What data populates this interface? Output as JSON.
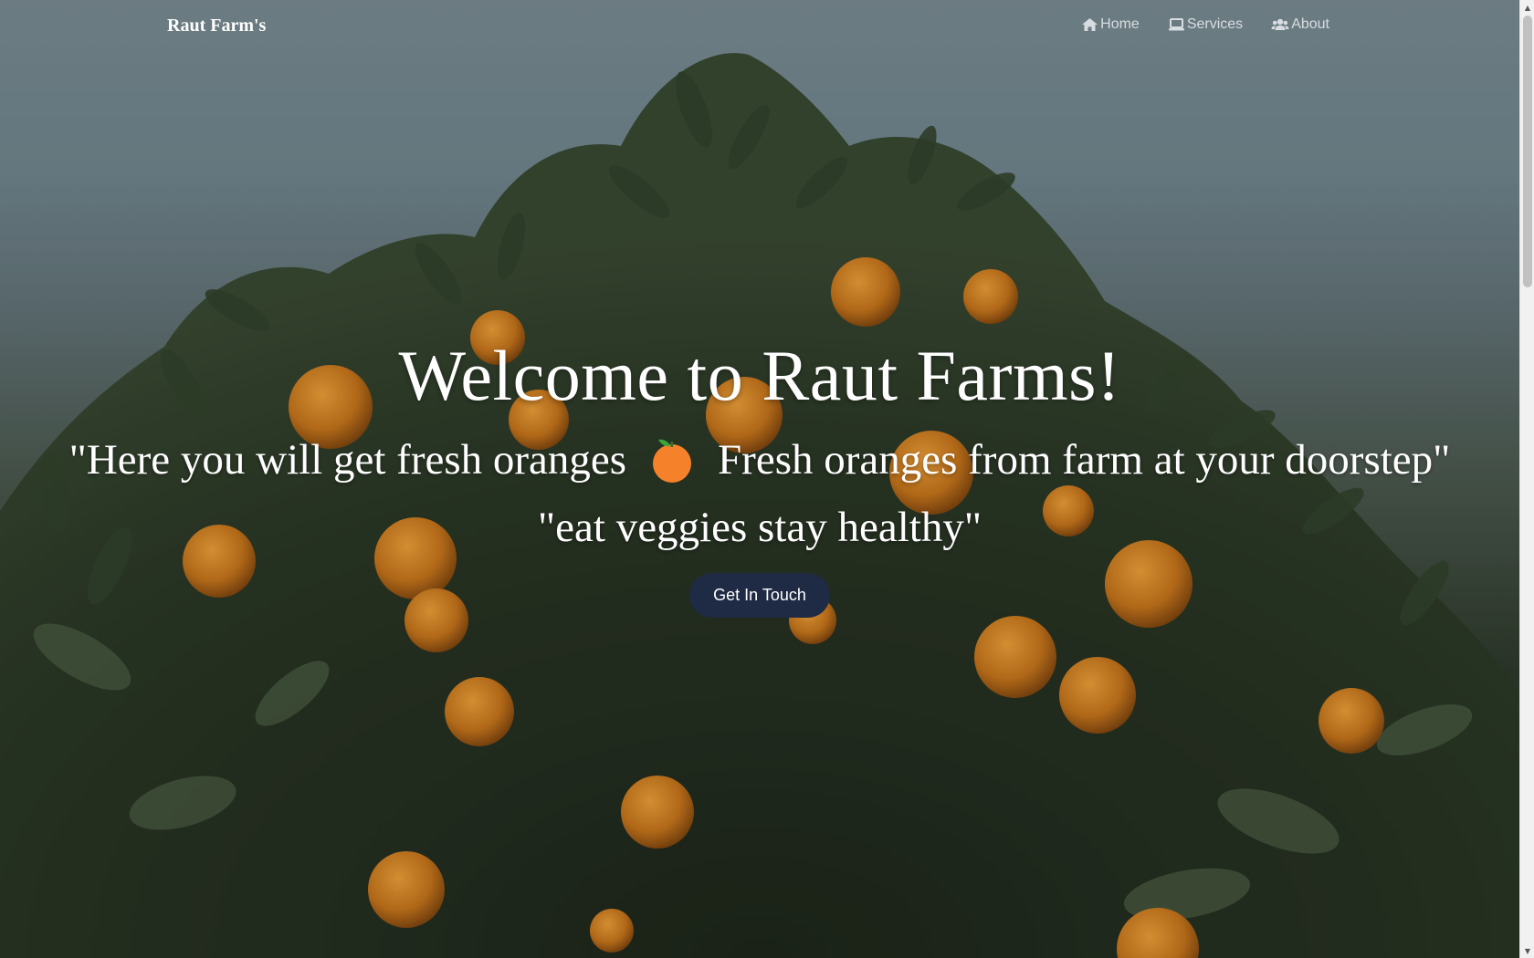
{
  "navbar": {
    "brand": "Raut Farm's",
    "links": [
      {
        "label": "Home",
        "icon": "home-icon"
      },
      {
        "label": "Services",
        "icon": "laptop-icon"
      },
      {
        "label": "About",
        "icon": "users-icon"
      }
    ]
  },
  "hero": {
    "title": "Welcome to Raut Farms!",
    "quote_part1": "\"Here you will get fresh oranges",
    "quote_icon": "orange-icon",
    "quote_part2": "Fresh oranges from farm at your doorstep\"",
    "tagline": "\"eat veggies stay healthy\"",
    "cta_label": "Get In Touch"
  },
  "colors": {
    "cta_background": "#1f2a44",
    "orange": "#f5822a",
    "leaf": "#2d3a26"
  }
}
